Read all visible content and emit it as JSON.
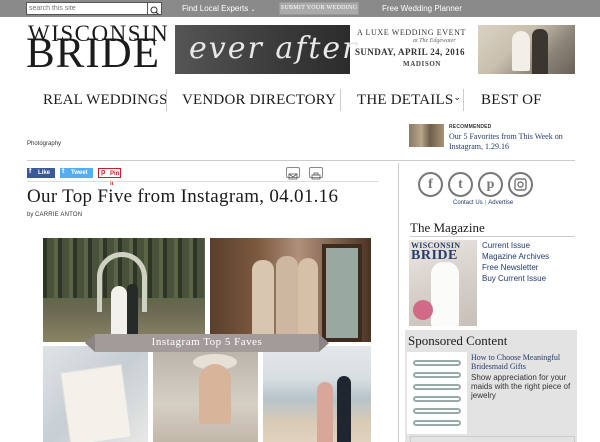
{
  "topbar": {
    "search_placeholder": "search this site",
    "find_local_experts": "Find Local Experts",
    "submit_wedding": "SUBMIT YOUR WEDDING",
    "free_planner": "Free Wedding Planner"
  },
  "logo": {
    "line1": "WISCONSIN",
    "line2": "BRIDE"
  },
  "ad": {
    "script": "ever after",
    "line1": "A LUXE WEDDING EVENT",
    "line2": "at The Edgewater",
    "line3": "SUNDAY, APRIL 24, 2016",
    "line4": "MADISON"
  },
  "nav": [
    "REAL WEDDINGS",
    "VENDOR DIRECTORY",
    "THE DETAILS",
    "BEST OF"
  ],
  "breadcrumb": "Photography",
  "recommended": {
    "label": "RECOMMENDED",
    "title": "Our 5 Favorites from This Week on Instagram, 1.29.16"
  },
  "share": {
    "facebook": "Like",
    "twitter": "Tweet",
    "pinterest": "Pin it"
  },
  "article": {
    "title": "Our Top Five from Instagram, 04.01.16",
    "by": "by",
    "author": "CARRIE ANTON",
    "banner": "Instagram Top 5 Faves"
  },
  "sidebar": {
    "contact": "Contact Us",
    "advertise": "Advertise",
    "magazine_heading": "The Magazine",
    "cover_line1": "WISCONSIN",
    "cover_line2": "BRIDE",
    "magazine_links": [
      "Current Issue",
      "Magazine Archives",
      "Free Newsletter",
      "Buy Current Issue"
    ],
    "sponsored_heading": "Sponsored Content",
    "sponsored_title": "How to Choose Meaningful Bridesmaid Gifts",
    "sponsored_desc": "Show appreciation for your maids with the right piece of jewelry"
  },
  "colors": {
    "topbar": "#8a8a8a",
    "link": "#233b6e",
    "facebook": "#3b5998",
    "twitter": "#55acee",
    "pinterest": "#cb2027"
  }
}
